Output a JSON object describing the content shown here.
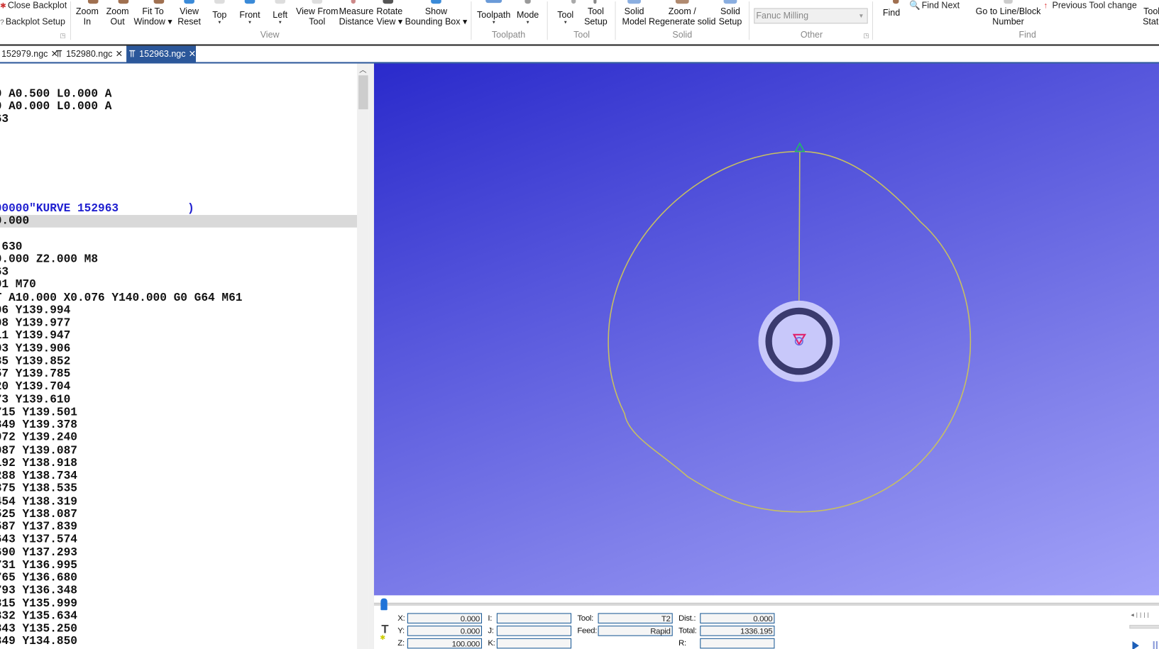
{
  "ribbon": {
    "backplot": {
      "close": "Close Backplot",
      "setup": "Backplot Setup"
    },
    "view": {
      "label": "View",
      "buttons": [
        {
          "label1": "Zoom",
          "label2": "In"
        },
        {
          "label1": "Zoom",
          "label2": "Out"
        },
        {
          "label1": "Fit To",
          "label2": "Window ▾"
        },
        {
          "label1": "View",
          "label2": "Reset"
        },
        {
          "label1": "Top",
          "label2": "▾"
        },
        {
          "label1": "Front",
          "label2": "▾"
        },
        {
          "label1": "Left",
          "label2": "▾"
        },
        {
          "label1": "View From",
          "label2": "Tool"
        },
        {
          "label1": "Measure",
          "label2": "Distance"
        },
        {
          "label1": "Rotate",
          "label2": "View ▾"
        },
        {
          "label1": "Show",
          "label2": "Bounding Box ▾"
        }
      ]
    },
    "toolpath": {
      "label": "Toolpath",
      "buttons": [
        {
          "label1": "Toolpath",
          "label2": "▾"
        },
        {
          "label1": "Mode",
          "label2": "▾"
        }
      ]
    },
    "tool": {
      "label": "Tool",
      "buttons": [
        {
          "label1": "Tool",
          "label2": "▾"
        },
        {
          "label1": "Tool",
          "label2": "Setup"
        }
      ]
    },
    "solid": {
      "label": "Solid",
      "buttons": [
        {
          "label1": "Solid",
          "label2": "Model"
        },
        {
          "label1": "Zoom /",
          "label2": "Regenerate solid"
        },
        {
          "label1": "Solid",
          "label2": "Setup"
        }
      ]
    },
    "other": {
      "label": "Other",
      "machine_select": "Fanuc Milling"
    },
    "find": {
      "label": "Find",
      "find": "Find",
      "find_next": "Find Next",
      "goto1": "Go to Line/Block",
      "goto2": "Number",
      "prev_tool": "Previous Tool change",
      "tool_station1": "Tool",
      "tool_station2": "Stati"
    }
  },
  "tabs": [
    {
      "label": "152979.ngc",
      "active": false
    },
    {
      "label": "152980.ngc",
      "active": false
    },
    {
      "label": "152963.ngc",
      "active": true
    }
  ],
  "editor": {
    "lines": [
      "0 A0.500 L0.000 A",
      "0 A0.000 L0.000 A",
      "63",
      "",
      "",
      "",
      "",
      "",
      "",
      "00000\"KURVE 152963          )",
      "0.000",
      "",
      "-630",
      "0.000 Z2.000 M8",
      "63",
      "01 M70",
      "T A10.000 X0.076 Y140.000 G0 G64 M61",
      "06 Y139.994",
      "08 Y139.977",
      "11 Y139.947",
      "03 Y139.906",
      "35 Y139.852",
      "57 Y139.785",
      "20 Y139.704",
      "73 Y139.610",
      "715 Y139.501",
      "349 Y139.378",
      "972 Y139.240",
      "087 Y139.087",
      "192 Y138.918",
      "288 Y138.734",
      "375 Y138.535",
      "454 Y138.319",
      "525 Y138.087",
      "587 Y137.839",
      "643 Y137.574",
      "690 Y137.293",
      "731 Y136.995",
      "765 Y136.680",
      "793 Y136.348",
      "815 Y135.999",
      "832 Y135.634",
      "843 Y135.250",
      "849 Y134.850"
    ],
    "comment_line_index": 9,
    "highlighted_line_index": 10
  },
  "viewport": {
    "colors": {
      "background_top": "#2a2acb",
      "background_bottom": "#a2a2f8",
      "toolpath": "#c8c060",
      "tool_holder": "#3a3a6e",
      "tool_disc": "#c8c8fa",
      "marker": "#e0206a",
      "start_marker": "#20c060"
    }
  },
  "status": {
    "labels": {
      "x": "X:",
      "y": "Y:",
      "z": "Z:",
      "i": "I:",
      "j": "J:",
      "k": "K:",
      "tool": "Tool:",
      "feed": "Feed:",
      "dist": "Dist.:",
      "total": "Total:",
      "r": "R:"
    },
    "values": {
      "x": "0.000",
      "y": "0.000",
      "z": "100.000",
      "i": "",
      "j": "",
      "k": "",
      "tool": "T2",
      "feed": "Rapid",
      "dist": "0.000",
      "total": "1336.195",
      "r": ""
    },
    "playback_position": 0
  }
}
